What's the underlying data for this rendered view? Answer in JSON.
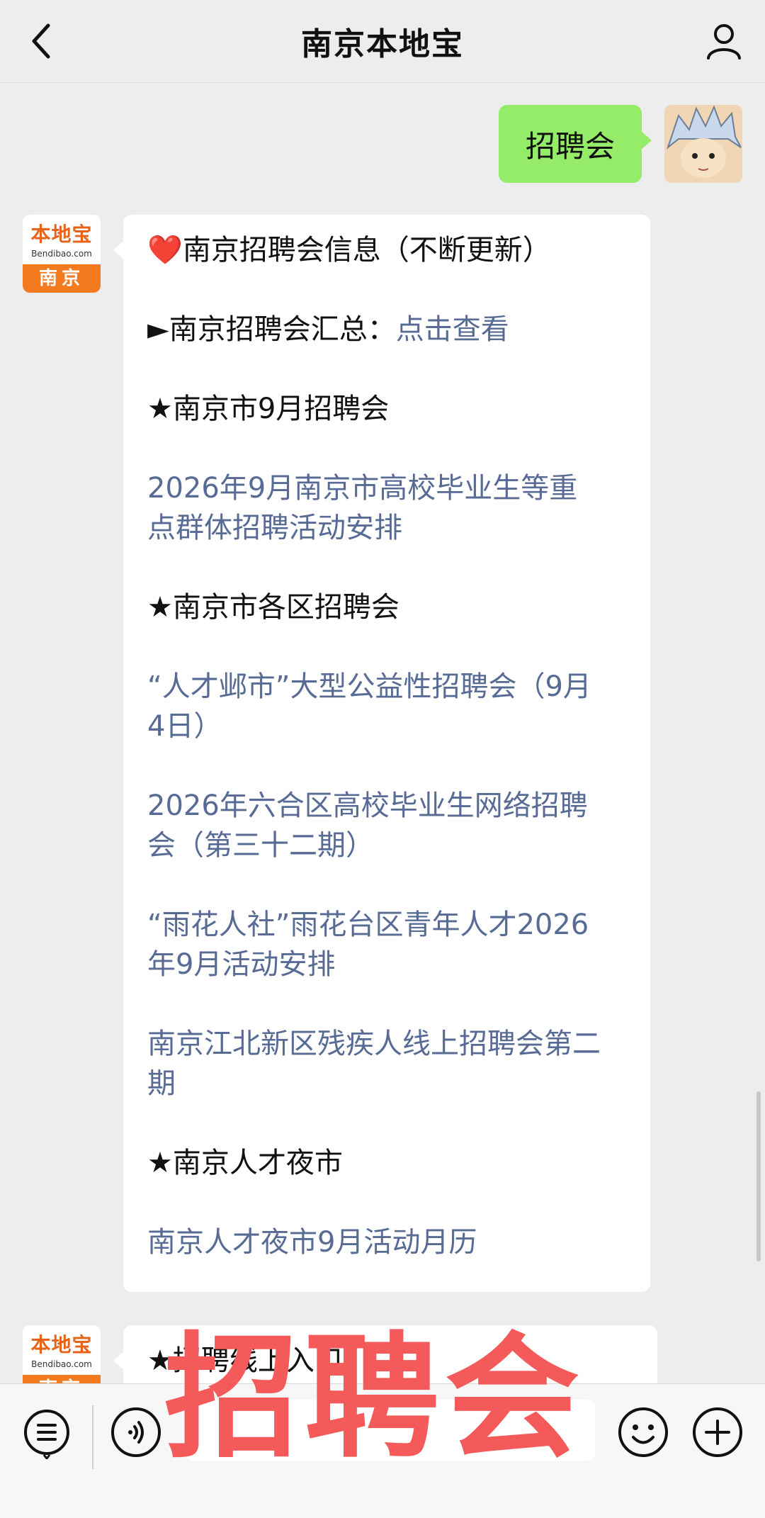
{
  "header": {
    "title": "南京本地宝"
  },
  "user_message": {
    "text": "招聘会"
  },
  "bot_avatar": {
    "logo_main": "本地宝",
    "logo_sub": "Bendibao.com",
    "city": "南京"
  },
  "message1": {
    "lines": [
      {
        "prefix": "❤️",
        "text": "南京招聘会信息（不断更新）",
        "type": "text"
      },
      {
        "text": "►南京招聘会汇总：",
        "link": "点击查看",
        "type": "mixed"
      },
      {
        "text": "★南京市9月招聘会",
        "type": "text"
      },
      {
        "text": "2026年9月南京市高校毕业生等重点群体招聘活动安排",
        "type": "link"
      },
      {
        "text": "★南京市各区招聘会",
        "type": "text"
      },
      {
        "text": "“人才邺市”大型公益性招聘会（9月4日）",
        "type": "link"
      },
      {
        "text": "2026年六合区高校毕业生网络招聘会（第三十二期）",
        "type": "link"
      },
      {
        "text": "“雨花人社”雨花台区青年人才2026年9月活动安排",
        "type": "link"
      },
      {
        "text": "南京江北新区残疾人线上招聘会第二期",
        "type": "link"
      },
      {
        "text": "★南京人才夜市",
        "type": "text"
      },
      {
        "text": "南京人才夜市9月活动月历",
        "type": "link"
      }
    ]
  },
  "message2": {
    "partial_text": "★招聘线上入口："
  },
  "overlay": {
    "text": "招聘会"
  },
  "colors": {
    "green_bubble": "#95ec69",
    "link": "#576b95",
    "overlay": "#f35a59",
    "logo_orange": "#f47a20"
  }
}
